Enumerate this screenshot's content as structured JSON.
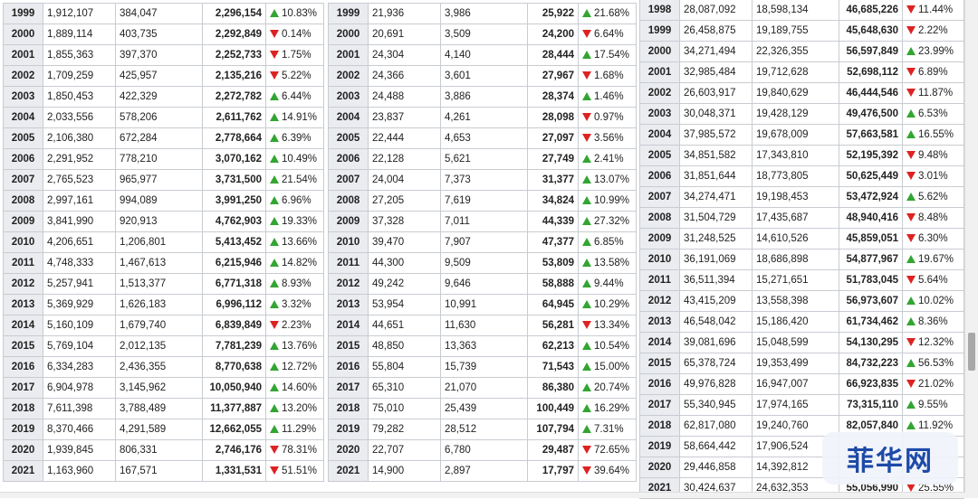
{
  "colors": {
    "up": "#33a532",
    "down": "#dd2222",
    "year_bg": "#eaecf0",
    "border": "#c8ccd2"
  },
  "watermark": "菲华网",
  "tables": [
    {
      "rows": [
        [
          "1999",
          "1,912,107",
          "384,047",
          "2,296,154",
          "up",
          "10.83%"
        ],
        [
          "2000",
          "1,889,114",
          "403,735",
          "2,292,849",
          "down",
          "0.14%"
        ],
        [
          "2001",
          "1,855,363",
          "397,370",
          "2,252,733",
          "down",
          "1.75%"
        ],
        [
          "2002",
          "1,709,259",
          "425,957",
          "2,135,216",
          "down",
          "5.22%"
        ],
        [
          "2003",
          "1,850,453",
          "422,329",
          "2,272,782",
          "up",
          "6.44%"
        ],
        [
          "2004",
          "2,033,556",
          "578,206",
          "2,611,762",
          "up",
          "14.91%"
        ],
        [
          "2005",
          "2,106,380",
          "672,284",
          "2,778,664",
          "up",
          "6.39%"
        ],
        [
          "2006",
          "2,291,952",
          "778,210",
          "3,070,162",
          "up",
          "10.49%"
        ],
        [
          "2007",
          "2,765,523",
          "965,977",
          "3,731,500",
          "up",
          "21.54%"
        ],
        [
          "2008",
          "2,997,161",
          "994,089",
          "3,991,250",
          "up",
          "6.96%"
        ],
        [
          "2009",
          "3,841,990",
          "920,913",
          "4,762,903",
          "up",
          "19.33%"
        ],
        [
          "2010",
          "4,206,651",
          "1,206,801",
          "5,413,452",
          "up",
          "13.66%"
        ],
        [
          "2011",
          "4,748,333",
          "1,467,613",
          "6,215,946",
          "up",
          "14.82%"
        ],
        [
          "2012",
          "5,257,941",
          "1,513,377",
          "6,771,318",
          "up",
          "8.93%"
        ],
        [
          "2013",
          "5,369,929",
          "1,626,183",
          "6,996,112",
          "up",
          "3.32%"
        ],
        [
          "2014",
          "5,160,109",
          "1,679,740",
          "6,839,849",
          "down",
          "2.23%"
        ],
        [
          "2015",
          "5,769,104",
          "2,012,135",
          "7,781,239",
          "up",
          "13.76%"
        ],
        [
          "2016",
          "6,334,283",
          "2,436,355",
          "8,770,638",
          "up",
          "12.72%"
        ],
        [
          "2017",
          "6,904,978",
          "3,145,962",
          "10,050,940",
          "up",
          "14.60%"
        ],
        [
          "2018",
          "7,611,398",
          "3,788,489",
          "11,377,887",
          "up",
          "13.20%"
        ],
        [
          "2019",
          "8,370,466",
          "4,291,589",
          "12,662,055",
          "up",
          "11.29%"
        ],
        [
          "2020",
          "1,939,845",
          "806,331",
          "2,746,176",
          "down",
          "78.31%"
        ],
        [
          "2021",
          "1,163,960",
          "167,571",
          "1,331,531",
          "down",
          "51.51%"
        ]
      ]
    },
    {
      "rows": [
        [
          "1999",
          "21,936",
          "3,986",
          "25,922",
          "up",
          "21.68%"
        ],
        [
          "2000",
          "20,691",
          "3,509",
          "24,200",
          "down",
          "6.64%"
        ],
        [
          "2001",
          "24,304",
          "4,140",
          "28,444",
          "up",
          "17.54%"
        ],
        [
          "2002",
          "24,366",
          "3,601",
          "27,967",
          "down",
          "1.68%"
        ],
        [
          "2003",
          "24,488",
          "3,886",
          "28,374",
          "up",
          "1.46%"
        ],
        [
          "2004",
          "23,837",
          "4,261",
          "28,098",
          "down",
          "0.97%"
        ],
        [
          "2005",
          "22,444",
          "4,653",
          "27,097",
          "down",
          "3.56%"
        ],
        [
          "2006",
          "22,128",
          "5,621",
          "27,749",
          "up",
          "2.41%"
        ],
        [
          "2007",
          "24,004",
          "7,373",
          "31,377",
          "up",
          "13.07%"
        ],
        [
          "2008",
          "27,205",
          "7,619",
          "34,824",
          "up",
          "10.99%"
        ],
        [
          "2009",
          "37,328",
          "7,011",
          "44,339",
          "up",
          "27.32%"
        ],
        [
          "2010",
          "39,470",
          "7,907",
          "47,377",
          "up",
          "6.85%"
        ],
        [
          "2011",
          "44,300",
          "9,509",
          "53,809",
          "up",
          "13.58%"
        ],
        [
          "2012",
          "49,242",
          "9,646",
          "58,888",
          "up",
          "9.44%"
        ],
        [
          "2013",
          "53,954",
          "10,991",
          "64,945",
          "up",
          "10.29%"
        ],
        [
          "2014",
          "44,651",
          "11,630",
          "56,281",
          "down",
          "13.34%"
        ],
        [
          "2015",
          "48,850",
          "13,363",
          "62,213",
          "up",
          "10.54%"
        ],
        [
          "2016",
          "55,804",
          "15,739",
          "71,543",
          "up",
          "15.00%"
        ],
        [
          "2017",
          "65,310",
          "21,070",
          "86,380",
          "up",
          "20.74%"
        ],
        [
          "2018",
          "75,010",
          "25,439",
          "100,449",
          "up",
          "16.29%"
        ],
        [
          "2019",
          "79,282",
          "28,512",
          "107,794",
          "up",
          "7.31%"
        ],
        [
          "2020",
          "22,707",
          "6,780",
          "29,487",
          "down",
          "72.65%"
        ],
        [
          "2021",
          "14,900",
          "2,897",
          "17,797",
          "down",
          "39.64%"
        ]
      ]
    },
    {
      "rows": [
        [
          "1998",
          "28,087,092",
          "18,598,134",
          "46,685,226",
          "down",
          "11.44%"
        ],
        [
          "1999",
          "26,458,875",
          "19,189,755",
          "45,648,630",
          "down",
          "2.22%"
        ],
        [
          "2000",
          "34,271,494",
          "22,326,355",
          "56,597,849",
          "up",
          "23.99%"
        ],
        [
          "2001",
          "32,985,484",
          "19,712,628",
          "52,698,112",
          "down",
          "6.89%"
        ],
        [
          "2002",
          "26,603,917",
          "19,840,629",
          "46,444,546",
          "down",
          "11.87%"
        ],
        [
          "2003",
          "30,048,371",
          "19,428,129",
          "49,476,500",
          "up",
          "6.53%"
        ],
        [
          "2004",
          "37,985,572",
          "19,678,009",
          "57,663,581",
          "up",
          "16.55%"
        ],
        [
          "2005",
          "34,851,582",
          "17,343,810",
          "52,195,392",
          "down",
          "9.48%"
        ],
        [
          "2006",
          "31,851,644",
          "18,773,805",
          "50,625,449",
          "down",
          "3.01%"
        ],
        [
          "2007",
          "34,274,471",
          "19,198,453",
          "53,472,924",
          "up",
          "5.62%"
        ],
        [
          "2008",
          "31,504,729",
          "17,435,687",
          "48,940,416",
          "down",
          "8.48%"
        ],
        [
          "2009",
          "31,248,525",
          "14,610,526",
          "45,859,051",
          "down",
          "6.30%"
        ],
        [
          "2010",
          "36,191,069",
          "18,686,898",
          "54,877,967",
          "up",
          "19.67%"
        ],
        [
          "2011",
          "36,511,394",
          "15,271,651",
          "51,783,045",
          "down",
          "5.64%"
        ],
        [
          "2012",
          "43,415,209",
          "13,558,398",
          "56,973,607",
          "up",
          "10.02%"
        ],
        [
          "2013",
          "46,548,042",
          "15,186,420",
          "61,734,462",
          "up",
          "8.36%"
        ],
        [
          "2014",
          "39,081,696",
          "15,048,599",
          "54,130,295",
          "down",
          "12.32%"
        ],
        [
          "2015",
          "65,378,724",
          "19,353,499",
          "84,732,223",
          "up",
          "56.53%"
        ],
        [
          "2016",
          "49,976,828",
          "16,947,007",
          "66,923,835",
          "down",
          "21.02%"
        ],
        [
          "2017",
          "55,340,945",
          "17,974,165",
          "73,315,110",
          "up",
          "9.55%"
        ],
        [
          "2018",
          "62,817,080",
          "19,240,760",
          "82,057,840",
          "up",
          "11.92%"
        ],
        [
          "2019",
          "58,664,442",
          "17,906,524",
          "",
          "",
          ""
        ],
        [
          "2020",
          "29,446,858",
          "14,392,812",
          "",
          "",
          ""
        ],
        [
          "2021",
          "30,424,637",
          "24,632,353",
          "55,056,990",
          "down",
          "25.55%"
        ]
      ]
    }
  ]
}
